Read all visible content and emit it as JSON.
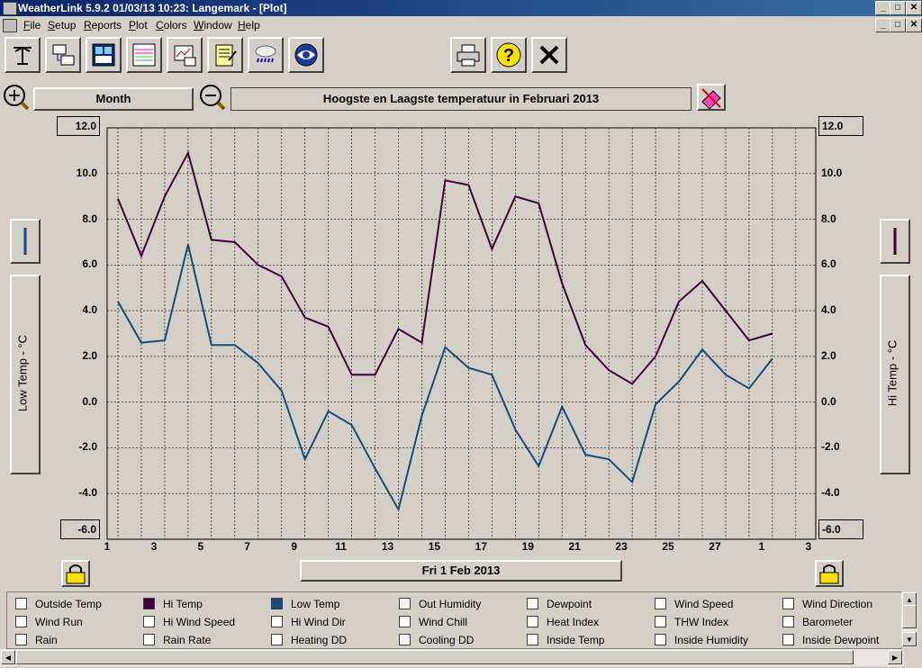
{
  "window": {
    "title": "WeatherLink 5.9.2  01/03/13  10:23: Langemark - [Plot]",
    "min": "_",
    "max": "□",
    "close": "✕"
  },
  "menu": [
    "File",
    "Setup",
    "Reports",
    "Plot",
    "Colors",
    "Window",
    "Help"
  ],
  "toolbar": {
    "icons": [
      "station-icon",
      "network-icon",
      "bulletin-icon",
      "summary-icon",
      "graph-icon",
      "notes-icon",
      "storm-icon",
      "noaa-icon",
      "print-icon",
      "help-icon",
      "close-icon"
    ]
  },
  "plot": {
    "span_label": "Month",
    "title": "Hoogste en Laagste temperatuur in Februari 2013",
    "date_label": "Fri 1 Feb 2013",
    "y_left_max": "12.0",
    "y_left_min": "-6.0",
    "y_right_max": "12.0",
    "y_right_min": "-6.0",
    "left_axis_label": "Low Temp - °C",
    "right_axis_label": "Hi Temp - °C",
    "left_ticks": [
      "10.0",
      "8.0",
      "6.0",
      "4.0",
      "2.0",
      "0.0",
      "-2.0",
      "-4.0"
    ],
    "right_ticks": [
      "10.0",
      "8.0",
      "6.0",
      "4.0",
      "2.0",
      "0.0",
      "-2.0",
      "-4.0"
    ],
    "x_ticks": [
      "1",
      "3",
      "5",
      "7",
      "9",
      "11",
      "13",
      "15",
      "17",
      "19",
      "21",
      "23",
      "25",
      "27",
      "1",
      "3"
    ]
  },
  "chart_data": {
    "type": "line",
    "title": "Hoogste en Laagste temperatuur in Februari 2013",
    "xlabel": "Fri 1 Feb 2013",
    "ylabel": "Low Temp - °C",
    "y2label": "Hi Temp - °C",
    "ylim": [
      -6,
      12
    ],
    "x": [
      "Feb 1",
      "Feb 2",
      "Feb 3",
      "Feb 4",
      "Feb 5",
      "Feb 6",
      "Feb 7",
      "Feb 8",
      "Feb 9",
      "Feb 10",
      "Feb 11",
      "Feb 12",
      "Feb 13",
      "Feb 14",
      "Feb 15",
      "Feb 16",
      "Feb 17",
      "Feb 18",
      "Feb 19",
      "Feb 20",
      "Feb 21",
      "Feb 22",
      "Feb 23",
      "Feb 24",
      "Feb 25",
      "Feb 26",
      "Feb 27",
      "Feb 28",
      "Mar 1"
    ],
    "x_day_index": [
      1,
      2,
      3,
      4,
      5,
      6,
      7,
      8,
      9,
      10,
      11,
      12,
      13,
      14,
      15,
      16,
      17,
      18,
      19,
      20,
      21,
      22,
      23,
      24,
      25,
      26,
      27,
      28,
      29
    ],
    "x_tick_labels": [
      "1",
      "3",
      "5",
      "7",
      "9",
      "11",
      "13",
      "15",
      "17",
      "19",
      "21",
      "23",
      "25",
      "27",
      "1",
      "3"
    ],
    "series": [
      {
        "name": "Hi Temp",
        "color": "#400040",
        "values": [
          8.9,
          6.4,
          9.0,
          10.9,
          7.1,
          7.0,
          6.0,
          5.5,
          3.7,
          3.3,
          1.2,
          1.2,
          3.2,
          2.6,
          9.7,
          9.5,
          6.7,
          9.0,
          8.7,
          5.2,
          2.5,
          1.4,
          0.8,
          2.0,
          4.4,
          5.3,
          4.0,
          2.7,
          3.0
        ]
      },
      {
        "name": "Low Temp",
        "color": "#1a4a78",
        "values": [
          4.4,
          2.6,
          2.7,
          6.9,
          2.5,
          2.5,
          1.7,
          0.5,
          -2.5,
          -0.4,
          -1.0,
          -2.9,
          -4.7,
          -0.6,
          2.4,
          1.5,
          1.2,
          -1.2,
          -2.8,
          -0.2,
          -2.3,
          -2.5,
          -3.5,
          -0.1,
          0.9,
          2.3,
          1.2,
          0.6,
          1.9
        ]
      }
    ],
    "grid": true
  },
  "legend": [
    [
      {
        "label": "Outside Temp",
        "color": "#ffffff"
      },
      {
        "label": "Hi Temp",
        "color": "#400040"
      },
      {
        "label": "Low Temp",
        "color": "#1a4a78"
      },
      {
        "label": "Out Humidity",
        "color": "#ffffff"
      },
      {
        "label": "Dewpoint",
        "color": "#ffffff"
      },
      {
        "label": "Wind Speed",
        "color": "#ffffff"
      },
      {
        "label": "Wind Direction",
        "color": "#ffffff"
      }
    ],
    [
      {
        "label": "Wind Run",
        "color": "#ffffff"
      },
      {
        "label": "Hi Wind Speed",
        "color": "#ffffff"
      },
      {
        "label": "Hi Wind Dir",
        "color": "#ffffff"
      },
      {
        "label": "Wind Chill",
        "color": "#ffffff"
      },
      {
        "label": "Heat Index",
        "color": "#ffffff"
      },
      {
        "label": "THW Index",
        "color": "#ffffff"
      },
      {
        "label": "Barometer",
        "color": "#ffffff"
      }
    ],
    [
      {
        "label": "Rain",
        "color": "#ffffff"
      },
      {
        "label": "Rain Rate",
        "color": "#ffffff"
      },
      {
        "label": "Heating DD",
        "color": "#ffffff"
      },
      {
        "label": "Cooling DD",
        "color": "#ffffff"
      },
      {
        "label": "Inside Temp",
        "color": "#ffffff"
      },
      {
        "label": "Inside Humidity",
        "color": "#ffffff"
      },
      {
        "label": "Inside Dewpoint",
        "color": "#ffffff"
      }
    ]
  ]
}
